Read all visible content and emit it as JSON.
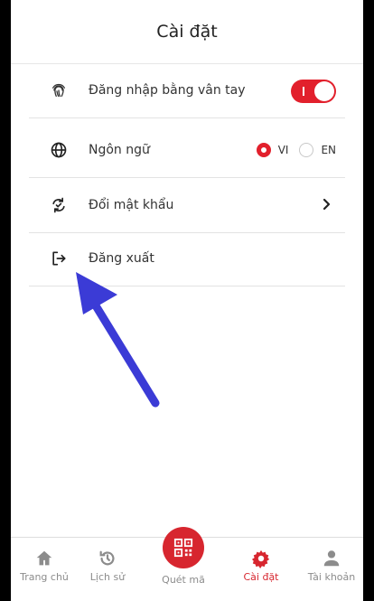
{
  "header": {
    "title": "Cài đặt"
  },
  "settings": {
    "fingerprint": {
      "label": "Đăng nhập bằng vân tay",
      "enabled": true
    },
    "language": {
      "label": "Ngôn ngữ",
      "options": [
        "VI",
        "EN"
      ],
      "selected": "VI"
    },
    "change_password": {
      "label": "Đổi mật khẩu"
    },
    "logout": {
      "label": "Đăng xuất"
    }
  },
  "tabbar": {
    "items": [
      {
        "label": "Trang chủ",
        "icon": "home-icon",
        "active": false
      },
      {
        "label": "Lịch sử",
        "icon": "history-icon",
        "active": false
      },
      {
        "label": "Quét mã",
        "icon": "qr-code-icon",
        "active": false
      },
      {
        "label": "Cài đặt",
        "icon": "gear-icon",
        "active": true
      },
      {
        "label": "Tài khoản",
        "icon": "user-icon",
        "active": false
      }
    ]
  },
  "colors": {
    "accent": "#e2202c",
    "inactive_tab": "#8c8c8c",
    "arrow": "#3b3bd6"
  }
}
